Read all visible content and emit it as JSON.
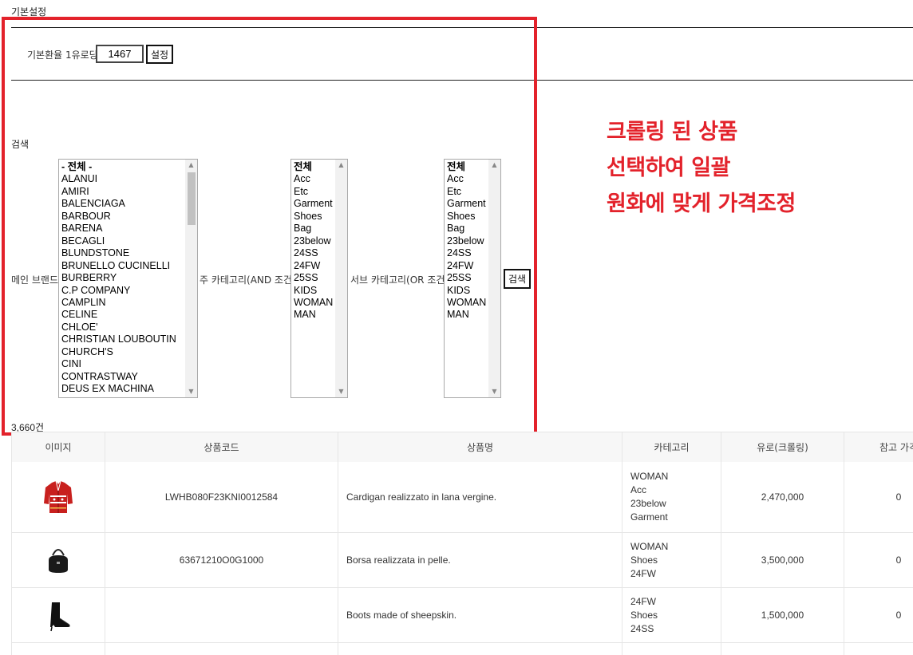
{
  "settings": {
    "section_title": "기본설정",
    "rate_label": "기본환율 1유로당",
    "rate_value": "1467",
    "set_button": "설정"
  },
  "search": {
    "section_title": "검색",
    "main_brand_label": "메인 브랜드",
    "main_category_label": "주 카테고리(AND 조건)",
    "sub_category_label": "서브 카테고리(OR 조건)",
    "search_button": "검색",
    "brands": [
      "- 전체 -",
      "ALANUI",
      "AMIRI",
      "BALENCIAGA",
      "BARBOUR",
      "BARENA",
      "BECAGLI",
      "BLUNDSTONE",
      "BRUNELLO CUCINELLI",
      "BURBERRY",
      "C.P COMPANY",
      "CAMPLIN",
      "CELINE",
      "CHLOE'",
      "CHRISTIAN LOUBOUTIN",
      "CHURCH'S",
      "CINI",
      "CONTRASTWAY",
      "DEUS EX MACHINA"
    ],
    "main_categories": [
      "전체",
      "Acc",
      "Etc",
      "Garment",
      "Shoes",
      "Bag",
      "23below",
      "24SS",
      "24FW",
      "25SS",
      "KIDS",
      "WOMAN",
      "MAN"
    ],
    "sub_categories": [
      "전체",
      "Acc",
      "Etc",
      "Garment",
      "Shoes",
      "Bag",
      "23below",
      "24SS",
      "24FW",
      "25SS",
      "KIDS",
      "WOMAN",
      "MAN"
    ]
  },
  "result_count": "3,660건",
  "annotation": {
    "lines": [
      "크롤링 된 상품",
      "선택하여 일괄",
      "원화에 맞게 가격조정"
    ],
    "color": "#e3222b"
  },
  "table": {
    "headers": [
      "이미지",
      "상품코드",
      "상품명",
      "카테고리",
      "유로(크롤링)",
      "참고 가격"
    ],
    "rows": [
      {
        "image": "red-cardigan-image",
        "code": "LWHB080F23KNI0012584",
        "name": "Cardigan realizzato in lana vergine.",
        "categories": [
          "WOMAN",
          "Acc",
          "23below",
          "Garment"
        ],
        "euro": "2,470,000",
        "ref": "0"
      },
      {
        "image": "black-bag-image",
        "code": "63671210O0G1000",
        "name": "Borsa realizzata in pelle.",
        "categories": [
          "WOMAN",
          "Shoes",
          "24FW"
        ],
        "euro": "3,500,000",
        "ref": "0"
      },
      {
        "image": "black-boot-image",
        "code": "",
        "name": "Boots made of sheepskin.",
        "categories": [
          "24FW",
          "Shoes",
          "24SS"
        ],
        "euro": "1,500,000",
        "ref": "0"
      }
    ]
  }
}
